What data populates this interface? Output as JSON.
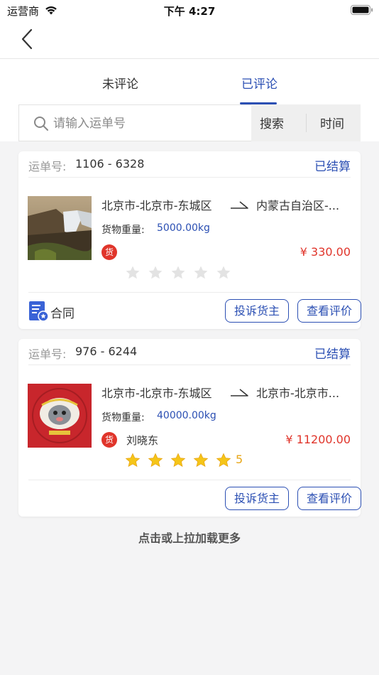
{
  "status_bar": {
    "carrier": "运营商",
    "time": "下午 4:27"
  },
  "tabs": [
    {
      "label": "未评论",
      "active": false
    },
    {
      "label": "已评论",
      "active": true
    }
  ],
  "search": {
    "placeholder": "请输入运单号",
    "button_label": "搜索",
    "time_label": "时间"
  },
  "orders": [
    {
      "waybill_label": "运单号:",
      "waybill_number": "1106 - 6328",
      "status": "已结算",
      "from": "北京市-北京市-东城区",
      "to": "内蒙古自治区-...",
      "weight_label": "货物重量:",
      "weight_value": "5000.00kg",
      "cargo_badge": "货",
      "shipper": "",
      "price": "¥ 330.00",
      "rating": 0,
      "contract_label": "合同",
      "complain_label": "投诉货主",
      "view_review_label": "查看评价"
    },
    {
      "waybill_label": "运单号:",
      "waybill_number": "976 - 6244",
      "status": "已结算",
      "from": "北京市-北京市-东城区",
      "to": "北京市-北京市...",
      "weight_label": "货物重量:",
      "weight_value": "40000.00kg",
      "cargo_badge": "货",
      "shipper": "刘晓东",
      "price": "¥ 11200.00",
      "rating": 5,
      "rating_text": "5",
      "complain_label": "投诉货主",
      "view_review_label": "查看评价"
    }
  ],
  "load_more": "点击或上拉加载更多",
  "colors": {
    "accent": "#2b4fb3",
    "price": "#e0352b",
    "star_filled": "#f5c518",
    "star_empty": "#e3e3e3"
  },
  "icons": [
    "wifi-icon",
    "battery-icon",
    "back-chevron-icon",
    "search-icon",
    "route-arrow-icon",
    "star-icon",
    "contract-icon"
  ]
}
